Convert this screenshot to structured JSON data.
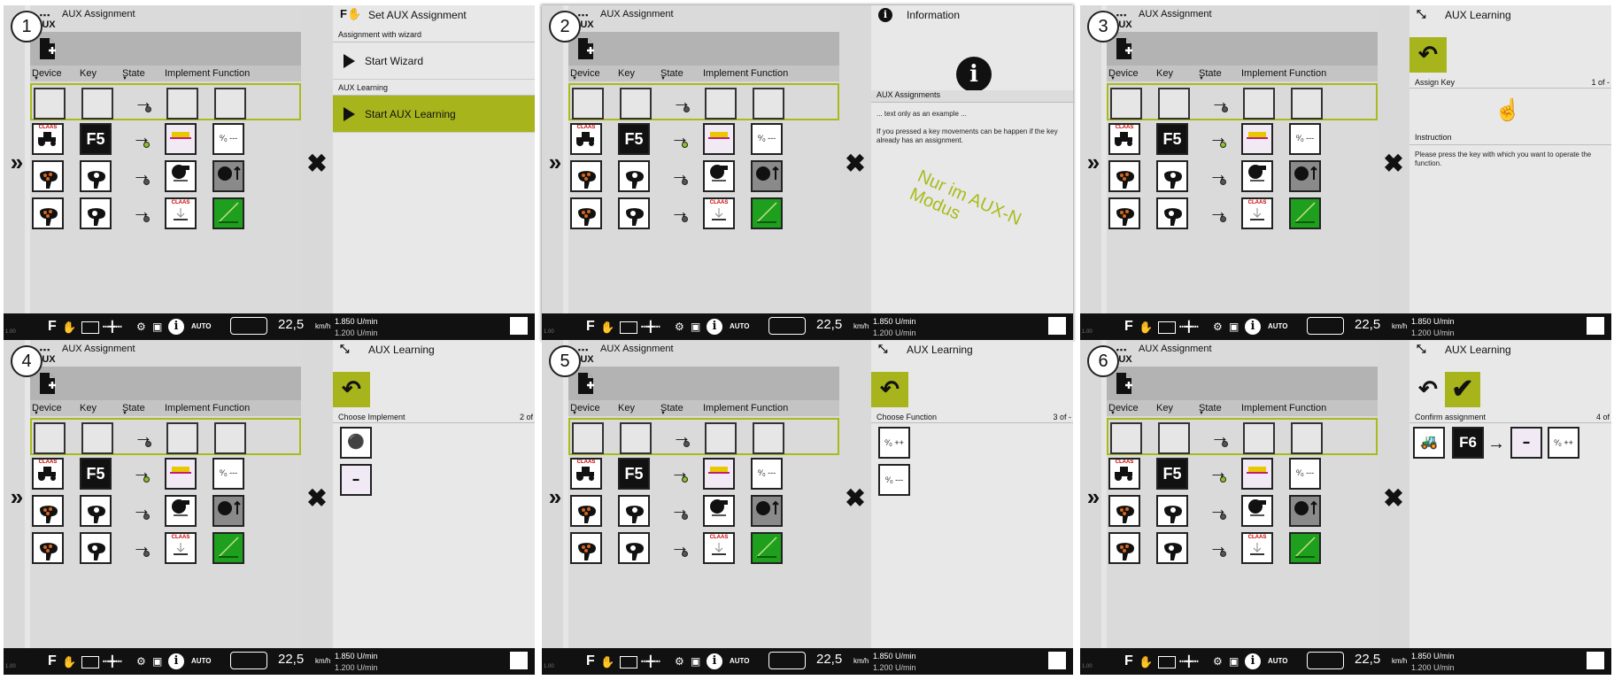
{
  "common": {
    "aux_logo": "AUX",
    "left_title": "AUX Assignment",
    "columns": [
      "Device",
      "Key",
      "State",
      "Implement",
      "Function"
    ],
    "key_label": "F5",
    "status": {
      "fkey": "F",
      "auto": "AUTO",
      "speed": "22,5",
      "speed_unit": "km/h",
      "rpm": "1.850 U/min",
      "rpm2": "1.200 U/min",
      "bottom": "1.00"
    },
    "brand_label": "CLAAS"
  },
  "panels": [
    {
      "num": "1",
      "right_title": "Set AUX Assignment",
      "section1": "Assignment with wizard",
      "button1": "Start Wizard",
      "section2": "AUX Learning",
      "button2": "Start AUX Learning"
    },
    {
      "num": "2",
      "right_title": "Information",
      "section": "AUX Assignments",
      "text1": "... text only as an example ...",
      "text2": "If you pressed a key movements can be happen if the key already has an assignment.",
      "overlay_line1": "Nur im  AUX-N",
      "overlay_line2": "Modus"
    },
    {
      "num": "3",
      "right_title": "AUX Learning",
      "step": "Assign Key",
      "step_count": "1 of -",
      "instr_label": "Instruction",
      "instr_text": "Please press the key with which you want to operate the function."
    },
    {
      "num": "4",
      "right_title": "AUX Learning",
      "step": "Choose Implement",
      "step_count": "2 of"
    },
    {
      "num": "5",
      "right_title": "AUX Learning",
      "step": "Choose Function",
      "step_count": "3 of -"
    },
    {
      "num": "6",
      "right_title": "AUX Learning",
      "step": "Confirm assignment",
      "step_count": "4 of",
      "key": "F6"
    }
  ],
  "colors": {
    "accent": "#a7b41b",
    "highlight_border": "#a9bb1a",
    "green_function": "#1ea01e",
    "status_bar": "#111111"
  }
}
